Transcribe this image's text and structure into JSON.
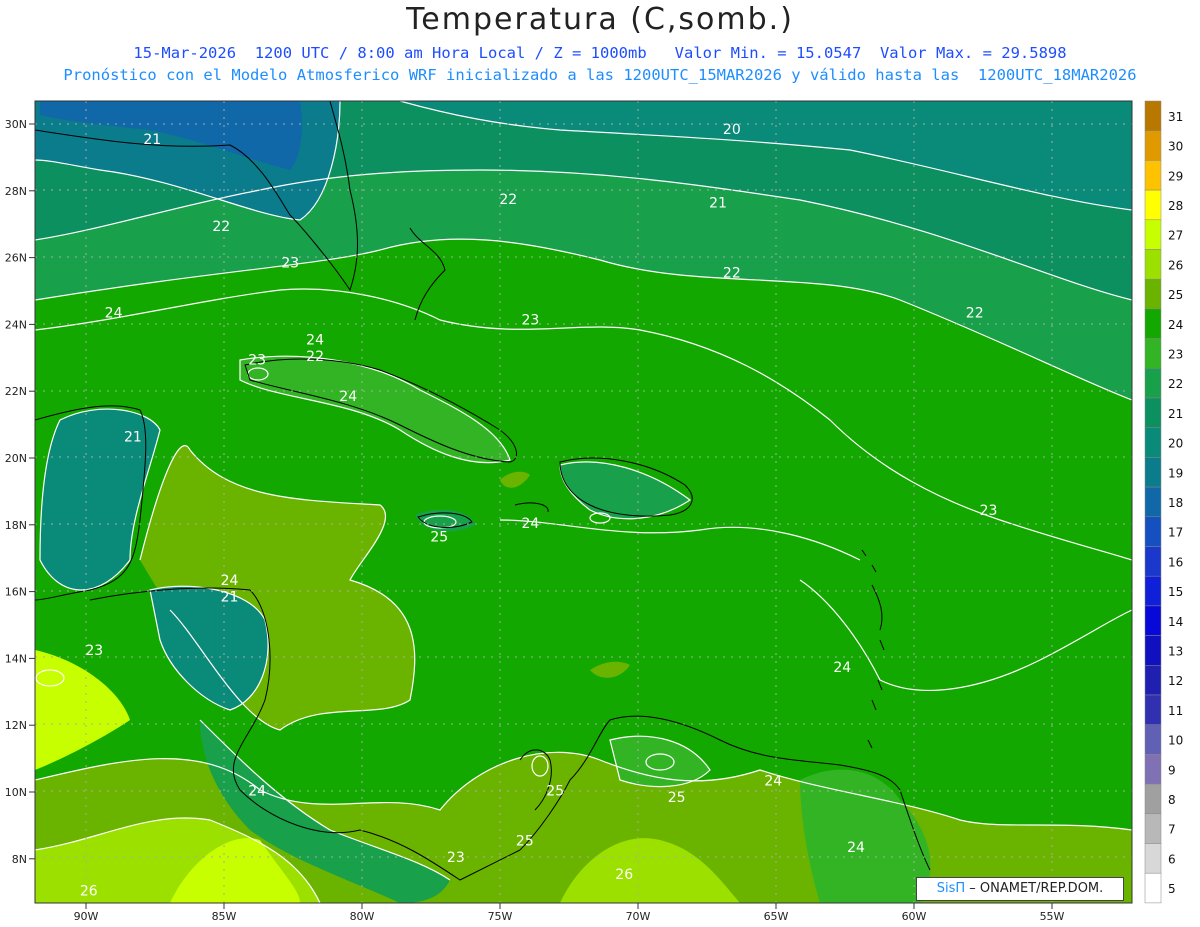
{
  "header": {
    "title": "Temperatura (C,somb.)",
    "line1": "15-Mar-2026  1200 UTC / 8:00 am Hora Local / Z = 1000mb   Valor Min. = 15.0547  Valor Max. = 29.5898",
    "line2": "Pronóstico con el Modelo Atmosferico WRF inicializado a las 1200UTC_15MAR2026 y válido hasta las  1200UTC_18MAR2026"
  },
  "map": {
    "lon_ticks": [
      "90W",
      "85W",
      "80W",
      "75W",
      "70W",
      "65W",
      "60W",
      "55W"
    ],
    "lat_ticks": [
      "30N",
      "28N",
      "26N",
      "24N",
      "22N",
      "20N",
      "18N",
      "16N",
      "14N",
      "12N",
      "10N",
      "8N"
    ],
    "contour_labels": [
      {
        "text": "21",
        "lon": -87.6,
        "lat": 29.4
      },
      {
        "text": "20",
        "lon": -66.6,
        "lat": 29.7
      },
      {
        "text": "22",
        "lon": -85.1,
        "lat": 26.8
      },
      {
        "text": "22",
        "lon": -74.7,
        "lat": 27.6
      },
      {
        "text": "21",
        "lon": -67.1,
        "lat": 27.5
      },
      {
        "text": "23",
        "lon": -82.6,
        "lat": 25.7
      },
      {
        "text": "22",
        "lon": -66.6,
        "lat": 25.4
      },
      {
        "text": "24",
        "lon": -89.0,
        "lat": 24.2
      },
      {
        "text": "23",
        "lon": -73.9,
        "lat": 24.0
      },
      {
        "text": "22",
        "lon": -57.8,
        "lat": 24.2
      },
      {
        "text": "24",
        "lon": -81.7,
        "lat": 23.4
      },
      {
        "text": "22",
        "lon": -81.7,
        "lat": 22.9
      },
      {
        "text": "23",
        "lon": -83.8,
        "lat": 22.8
      },
      {
        "text": "24",
        "lon": -80.5,
        "lat": 21.7
      },
      {
        "text": "21",
        "lon": -88.3,
        "lat": 20.5
      },
      {
        "text": "25",
        "lon": -77.2,
        "lat": 17.5
      },
      {
        "text": "24",
        "lon": -73.9,
        "lat": 17.9
      },
      {
        "text": "23",
        "lon": -57.3,
        "lat": 18.3
      },
      {
        "text": "24",
        "lon": -84.8,
        "lat": 16.2
      },
      {
        "text": "21",
        "lon": -84.8,
        "lat": 15.7
      },
      {
        "text": "23",
        "lon": -89.7,
        "lat": 14.1
      },
      {
        "text": "24",
        "lon": -62.6,
        "lat": 13.6
      },
      {
        "text": "24",
        "lon": -83.8,
        "lat": 9.9
      },
      {
        "text": "25",
        "lon": -73.0,
        "lat": 9.9
      },
      {
        "text": "25",
        "lon": -68.6,
        "lat": 9.7
      },
      {
        "text": "24",
        "lon": -65.1,
        "lat": 10.2
      },
      {
        "text": "25",
        "lon": -74.1,
        "lat": 8.4
      },
      {
        "text": "23",
        "lon": -76.6,
        "lat": 7.9
      },
      {
        "text": "24",
        "lon": -62.1,
        "lat": 8.2
      },
      {
        "text": "26",
        "lon": -70.5,
        "lat": 7.4
      },
      {
        "text": "26",
        "lon": -89.9,
        "lat": 6.9
      }
    ]
  },
  "colorbar": {
    "labels": [
      "31",
      "30",
      "29",
      "28",
      "27",
      "26",
      "25",
      "24",
      "23",
      "22",
      "21",
      "20",
      "19",
      "18",
      "17",
      "16",
      "15",
      "14",
      "13",
      "12",
      "11",
      "10",
      "9",
      "8",
      "7",
      "6",
      "5"
    ],
    "colors": [
      "#b87800",
      "#e09a00",
      "#ffc200",
      "#ffff00",
      "#c8ff00",
      "#9ce000",
      "#6ab400",
      "#13a800",
      "#32b424",
      "#18a04a",
      "#0c9060",
      "#0a8a78",
      "#0a7c8c",
      "#1068a8",
      "#1450c0",
      "#1a38cc",
      "#1020d8",
      "#0808d8",
      "#1010c0",
      "#2020b0",
      "#3030b0",
      "#6060b4",
      "#8070b4",
      "#a0a0a0",
      "#b8b8b8",
      "#d8d8d8",
      "#ffffff"
    ]
  },
  "credit": {
    "brand": "SisΠ",
    "text": " – ONAMET/REP.DOM."
  }
}
